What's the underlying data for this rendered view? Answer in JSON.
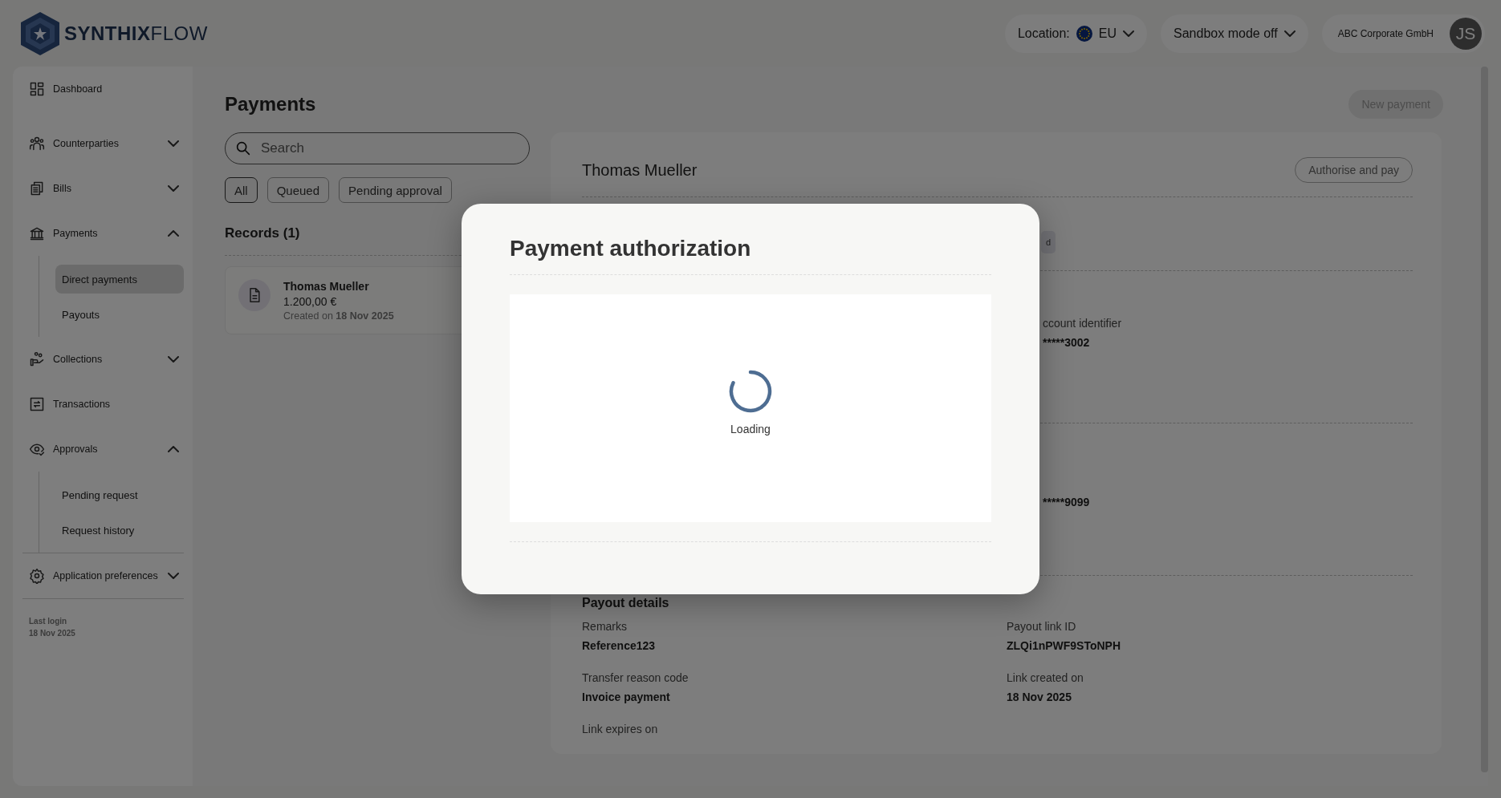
{
  "topbar": {
    "logo": "**SYNTHIX**FLOW",
    "location": {
      "label": "Location:",
      "value": "EU"
    },
    "sandbox": "Sandbox mode off",
    "account": {
      "name": "ABC Corporate GmbH",
      "initials": "JS"
    }
  },
  "sidebar": {
    "items": [
      {
        "label": "Dashboard",
        "selected": false
      },
      {
        "label": "Counterparties",
        "selected": false,
        "expanded": false
      },
      {
        "label": "Bills",
        "selected": false,
        "expanded": false
      },
      {
        "label": "Payments",
        "selected": false,
        "expanded": true,
        "children": [
          {
            "label": "Direct payments",
            "selected": true
          },
          {
            "label": "Payouts",
            "selected": false
          }
        ]
      },
      {
        "label": "Collections",
        "selected": false,
        "expanded": false
      },
      {
        "label": "Transactions",
        "selected": false
      },
      {
        "label": "Approvals",
        "selected": false,
        "expanded": true,
        "children": [
          {
            "label": "Pending request",
            "selected": false
          },
          {
            "label": "Request history",
            "selected": false
          }
        ]
      }
    ],
    "bottom_items": [
      {
        "label": "Application preferences",
        "selected": false,
        "expanded": false
      }
    ],
    "last_login": {
      "label": "Last login",
      "date": "18 Nov 2025"
    }
  },
  "payments": {
    "title": "Payments",
    "new_button": "New payment",
    "search": {
      "placeholder": "Search"
    },
    "filters": [
      {
        "label": "All",
        "selected": true
      },
      {
        "label": "Queued",
        "selected": false
      },
      {
        "label": "Pending approval",
        "selected": false
      }
    ],
    "records_title": "Records (1)",
    "records": [
      {
        "name": "Thomas Mueller",
        "amount": "1.200,00 €",
        "created": "Created on **18 Nov 2025**"
      }
    ]
  },
  "detail": {
    "title": "Thomas Mueller",
    "action": "Authorise and pay",
    "badge": "d",
    "sections": [
      {
        "label": "ccount identifier",
        "value": "*****3002"
      },
      {
        "value": "*****9099"
      }
    ],
    "payout": {
      "heading": "Payout details",
      "fields": [
        {
          "label": "Remarks",
          "value": "Reference123"
        },
        {
          "label": "Payout link ID",
          "value": "ZLQi1nPWF9SToNPH"
        },
        {
          "label": "Transfer reason code",
          "value": "Invoice payment"
        },
        {
          "label": "Link created on",
          "value": "18 Nov 2025"
        },
        {
          "label": "Link expires on"
        }
      ]
    }
  },
  "modal": {
    "title": "Payment authorization",
    "loading": "Loading"
  }
}
